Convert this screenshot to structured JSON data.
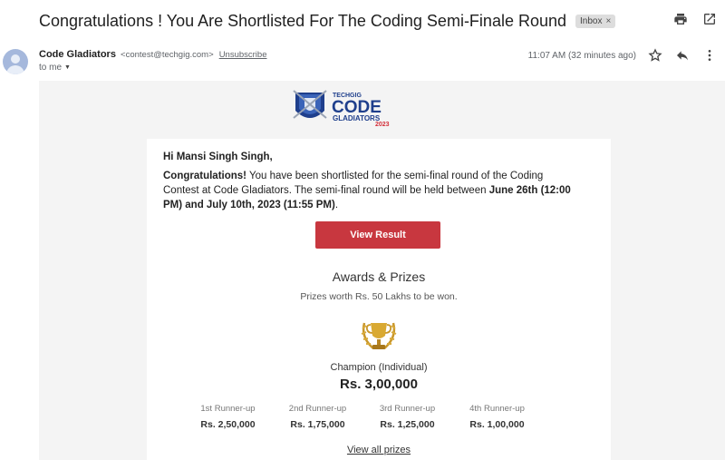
{
  "email": {
    "subject": "Congratulations ! You Are Shortlisted For The Coding Semi-Finale Round",
    "label_chip": "Inbox",
    "sender_name": "Code Gladiators",
    "sender_email": "<contest@techgig.com>",
    "unsubscribe": "Unsubscribe",
    "to": "to me",
    "time": "11:07 AM (32 minutes ago)"
  },
  "banner": {
    "brand": "TECHGIG",
    "title": "CODE",
    "subtitle": "GLADIATORS",
    "year": "2023"
  },
  "body": {
    "greeting": "Hi Mansi Singh Singh,",
    "msg_bold1": "Congratulations!",
    "msg_text1": " You have been shortlisted for the semi-final round of the Coding Contest at Code Gladiators. The semi-final round will be held between ",
    "msg_bold2": "June 26th (12:00 PM) and July 10th, 2023 (11:55 PM)",
    "msg_text2": ".",
    "button": "View Result",
    "awards_title": "Awards & Prizes",
    "awards_sub": "Prizes worth Rs. 50 Lakhs to be won.",
    "champion_label": "Champion (Individual)",
    "champion_amount": "Rs. 3,00,000",
    "runners": [
      {
        "label": "1st Runner-up",
        "amount": "Rs. 2,50,000"
      },
      {
        "label": "2nd Runner-up",
        "amount": "Rs. 1,75,000"
      },
      {
        "label": "3rd Runner-up",
        "amount": "Rs. 1,25,000"
      },
      {
        "label": "4th Runner-up",
        "amount": "Rs. 1,00,000"
      }
    ],
    "view_all": "View all prizes"
  },
  "colors": {
    "button_bg": "#c8373f",
    "banner_blue": "#1f3f8c",
    "banner_red": "#d32f3a",
    "trophy_gold": "#c9972a"
  },
  "icons": [
    "print-icon",
    "open-in-new-icon",
    "star-icon",
    "reply-icon",
    "more-vert-icon",
    "chevron-down-icon",
    "close-icon",
    "avatar-icon",
    "trophy-icon"
  ]
}
